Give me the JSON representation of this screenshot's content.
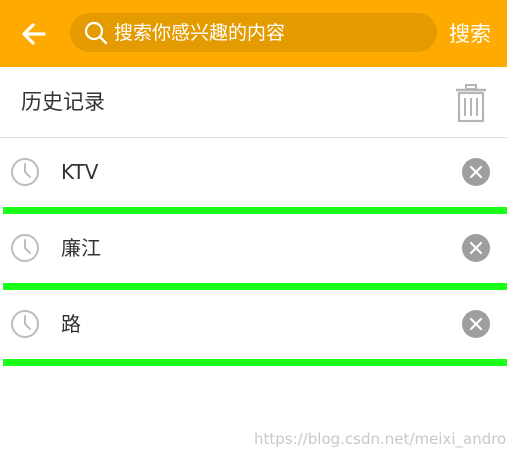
{
  "header": {
    "back_icon": "arrow-left-icon",
    "search_placeholder": "搜索你感兴趣的内容",
    "search_icon": "search-icon",
    "search_button_label": "搜索",
    "background_color": "#FFAA00"
  },
  "history": {
    "title": "历史记录",
    "clear_icon": "trash-icon",
    "items": [
      {
        "text": "KTV",
        "icon": "clock-icon",
        "delete_icon": "close-circle-icon"
      },
      {
        "text": "廉江",
        "icon": "clock-icon",
        "delete_icon": "close-circle-icon"
      },
      {
        "text": "路",
        "icon": "clock-icon",
        "delete_icon": "close-circle-icon"
      }
    ],
    "divider_color": "#1AFF1A"
  },
  "watermark": "https://blog.csdn.net/meixi_android"
}
